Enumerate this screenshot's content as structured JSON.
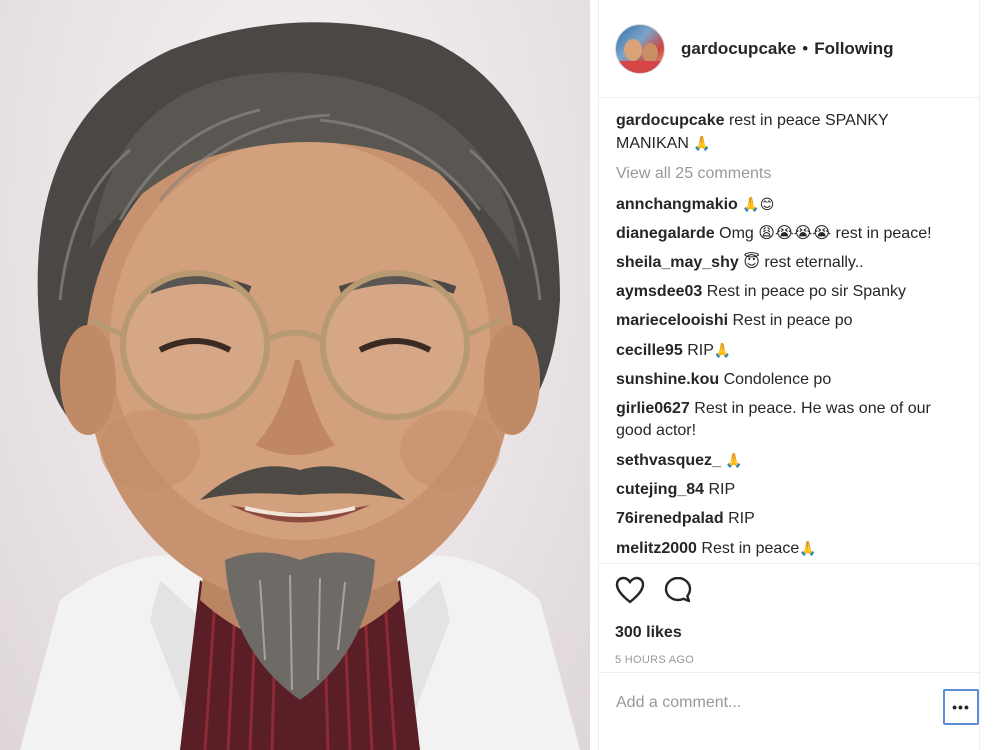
{
  "post": {
    "username": "gardocupcake",
    "separator": "•",
    "follow_status": "Following",
    "caption_user": "gardocupcake",
    "caption_text": "rest in peace SPANKY MANIKAN",
    "caption_emoji": "🙏",
    "view_all": "View all 25 comments",
    "likes": "300 likes",
    "time": "5 HOURS AGO",
    "add_comment_placeholder": "Add a comment...",
    "more_label": "•••"
  },
  "comments": [
    {
      "user": "annchangmakio",
      "text": "",
      "emoji": "🙏😊"
    },
    {
      "user": "dianegalarde",
      "text": "Omg 😩😭😭😭 rest in peace!",
      "emoji": ""
    },
    {
      "user": "sheila_may_shy",
      "text": "😇 rest eternally..",
      "emoji": ""
    },
    {
      "user": "aymsdee03",
      "text": "Rest in peace po sir Spanky",
      "emoji": ""
    },
    {
      "user": "mariecelooishi",
      "text": "Rest in peace po",
      "emoji": ""
    },
    {
      "user": "cecille95",
      "text": "RIP",
      "emoji": "🙏"
    },
    {
      "user": "sunshine.kou",
      "text": "Condolence po",
      "emoji": ""
    },
    {
      "user": "girlie0627",
      "text": "Rest in peace. He was one of our good actor!",
      "emoji": ""
    },
    {
      "user": "sethvasquez_",
      "text": "",
      "emoji": "🙏"
    },
    {
      "user": "cutejing_84",
      "text": "RIP",
      "emoji": ""
    },
    {
      "user": "76irenedpalad",
      "text": "RIP",
      "emoji": ""
    },
    {
      "user": "melitz2000",
      "text": "Rest in peace",
      "emoji": "🙏"
    }
  ],
  "icons": {
    "like": "heart-icon",
    "comment": "comment-icon",
    "more": "more-options-icon"
  },
  "colors": {
    "text": "#262626",
    "muted": "#999999",
    "border": "#efefef",
    "focus": "#5b8ed6"
  }
}
